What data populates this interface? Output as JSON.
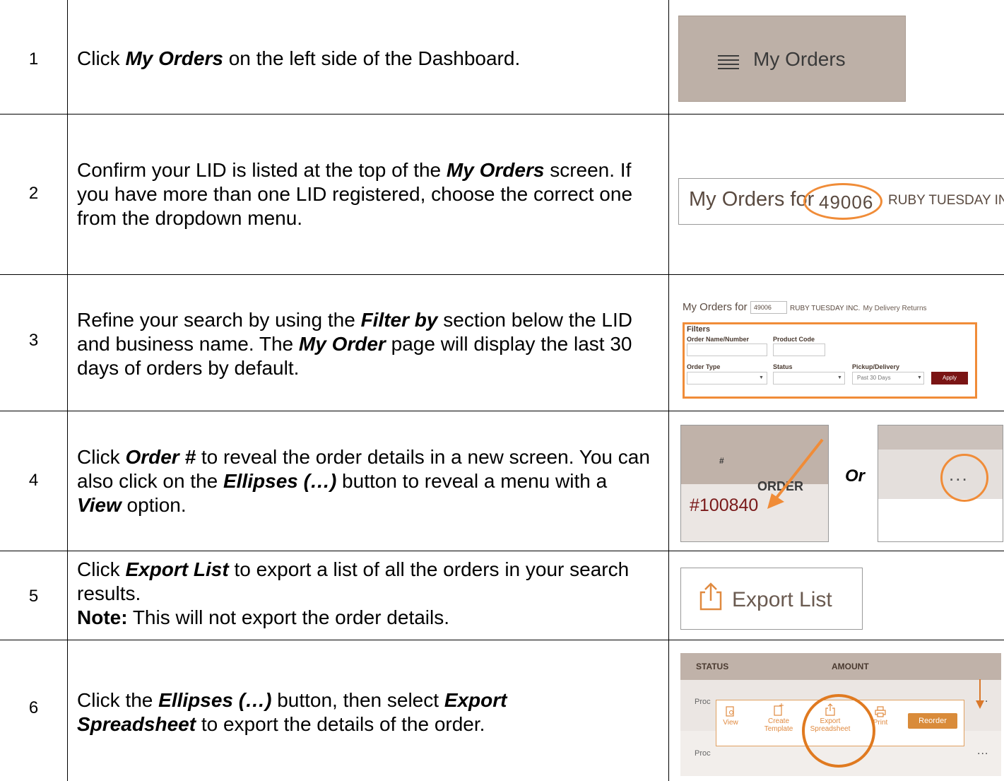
{
  "steps": [
    {
      "num": "1",
      "parts": [
        "Click ",
        "My Orders",
        " on the left side of the Dashboard."
      ]
    },
    {
      "num": "2",
      "parts": [
        "Confirm your LID is listed at the top of the ",
        "My Orders",
        " screen. If you have more than one LID registered, choose the correct one from the dropdown menu."
      ]
    },
    {
      "num": "3",
      "parts": [
        "Refine your search by using the ",
        "Filter by",
        " section below the LID and business name. The ",
        "My Order",
        " page will display the last 30 days of orders by default."
      ]
    },
    {
      "num": "4",
      "parts": [
        "Click ",
        "Order #",
        " to reveal the order details in a new screen. You can also click on the ",
        "Ellipses (…)",
        " button to reveal a menu with a ",
        "View",
        " option."
      ]
    },
    {
      "num": "5",
      "parts": [
        "Click ",
        "Export List",
        " to export a list of all the orders in your search results.",
        "Note:",
        " This will not export the order details."
      ]
    },
    {
      "num": "6",
      "parts": [
        "Click the ",
        "Ellipses (…)",
        " button, then select ",
        "Export Spreadsheet",
        " to export the details of the order."
      ]
    }
  ],
  "shot1": {
    "label": "My Orders"
  },
  "shot2": {
    "prefix": "My Orders for",
    "lid": "49006",
    "business": "RUBY TUESDAY INC."
  },
  "shot3": {
    "title": "My Orders for",
    "lid": "49006",
    "business": "RUBY TUESDAY INC.",
    "links": "My Delivery Returns",
    "filters_label": "Filters",
    "order_name_label": "Order Name/Number",
    "product_code_label": "Product Code",
    "order_type_label": "Order Type",
    "status_label": "Status",
    "pickup_label": "Pickup/Delivery",
    "pickup_value": "Past 30 Days",
    "apply_label": "Apply"
  },
  "shot4a": {
    "header": "ORDER",
    "header_suffix": "#",
    "value": "#100840"
  },
  "or_label": "Or",
  "shot4b": {
    "dots": "..."
  },
  "shot5": {
    "label": "Export List"
  },
  "shot6": {
    "status_col": "STATUS",
    "amount_col": "AMOUNT",
    "row1": "Proc",
    "row2": "Proc",
    "menu": [
      "View",
      "Create Template",
      "Export Spreadsheet",
      "Print"
    ],
    "reorder": "Reorder",
    "dots": "..."
  }
}
